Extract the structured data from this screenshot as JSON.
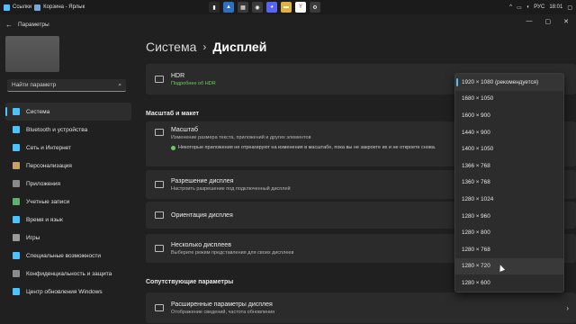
{
  "taskbar": {
    "left_items": [
      {
        "label": "Ссылки",
        "icon": "link-icon"
      },
      {
        "label": "Корзина - Ярлык",
        "icon": "recycle-bin-icon"
      }
    ],
    "apps": [
      {
        "name": "terminal-app",
        "glyph": "▮",
        "color": "#2a2a2a"
      },
      {
        "name": "photos-app",
        "glyph": "▲",
        "color": "#2e6fbf"
      },
      {
        "name": "calculator-app",
        "glyph": "▦",
        "color": "#3a3a3a"
      },
      {
        "name": "browser-app",
        "glyph": "◉",
        "color": "#3a3a3a"
      },
      {
        "name": "discord-app",
        "glyph": "◕",
        "color": "#5865f2"
      },
      {
        "name": "explorer-app",
        "glyph": "▬",
        "color": "#e0b040"
      },
      {
        "name": "yandex-app",
        "glyph": "Y",
        "color": "#ffffff"
      },
      {
        "name": "settings-app",
        "glyph": "⚙",
        "color": "#3a3a3a"
      }
    ],
    "lang": "РУС",
    "time": "18:01"
  },
  "window": {
    "title": "Параметры",
    "back": "←",
    "min": "—",
    "max": "▢",
    "close": "✕"
  },
  "sidebar": {
    "search_placeholder": "Найти параметр",
    "items": [
      {
        "label": "Система",
        "icon": "system-icon",
        "color": "#4cc2ff"
      },
      {
        "label": "Bluetooth и устройства",
        "icon": "bluetooth-icon",
        "color": "#4cc2ff"
      },
      {
        "label": "Сеть и Интернет",
        "icon": "network-icon",
        "color": "#4cc2ff"
      },
      {
        "label": "Персонализация",
        "icon": "brush-icon",
        "color": "#c9a26b"
      },
      {
        "label": "Приложения",
        "icon": "apps-icon",
        "color": "#8a8a8a"
      },
      {
        "label": "Учетные записи",
        "icon": "account-icon",
        "color": "#5fb06c"
      },
      {
        "label": "Время и язык",
        "icon": "globe-icon",
        "color": "#4cc2ff"
      },
      {
        "label": "Игры",
        "icon": "gamepad-icon",
        "color": "#9a9a9a"
      },
      {
        "label": "Специальные возможности",
        "icon": "accessibility-icon",
        "color": "#4cc2ff"
      },
      {
        "label": "Конфиденциальность и защита",
        "icon": "shield-icon",
        "color": "#8a8a8a"
      },
      {
        "label": "Центр обновления Windows",
        "icon": "update-icon",
        "color": "#4cc2ff"
      }
    ]
  },
  "main": {
    "breadcrumb_parent": "Система",
    "breadcrumb_sep": "›",
    "breadcrumb_current": "Дисплей",
    "hdr_title": "HDR",
    "hdr_link": "Подробнее об HDR",
    "section_scale": "Масштаб и макет",
    "scale_title": "Масштаб",
    "scale_desc": "Изменение размера текста, приложений и других элементов",
    "scale_warning": "Некоторые приложения не отреагируют на изменения в масштабе, пока вы не закроете их и не откроете снова.",
    "resolution_title": "Разрешение дисплея",
    "resolution_desc": "Настроить разрешение под подключенный дисплей",
    "orientation_title": "Ориентация дисплея",
    "multi_title": "Несколько дисплеев",
    "multi_desc": "Выберите режим представления для своих дисплеев",
    "section_related": "Сопутствующие параметры",
    "advanced_title": "Расширенные параметры дисплея",
    "advanced_desc": "Отображение сведений, частота обновления"
  },
  "resolution_dropdown": {
    "options": [
      "1920 × 1080 (рекомендуется)",
      "1680 × 1050",
      "1600 × 900",
      "1440 × 900",
      "1400 × 1050",
      "1366 × 768",
      "1360 × 768",
      "1280 × 1024",
      "1280 × 960",
      "1280 × 800",
      "1280 × 768",
      "1280 × 720",
      "1280 × 600"
    ],
    "selected_index": 0,
    "hover_index": 11
  }
}
